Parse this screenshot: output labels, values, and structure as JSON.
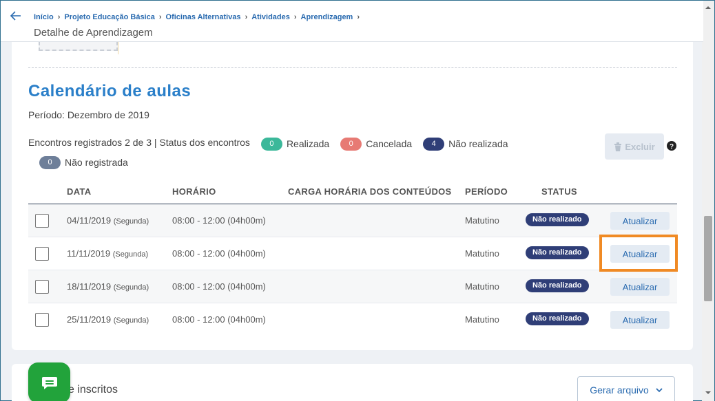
{
  "header": {
    "breadcrumb": [
      "Início",
      "Projeto Educação Básica",
      "Oficinas Alternativas",
      "Atividades",
      "Aprendizagem"
    ],
    "page_title": "Detalhe de Aprendizagem"
  },
  "calendar": {
    "title": "Calendário de aulas",
    "periodo": "Período: Dezembro de 2019",
    "encontros_text": "Encontros registrados 2 de 3 | Status dos encontros",
    "status_counts": [
      {
        "count": "0",
        "label": "Realizada",
        "color": "#3bb89a"
      },
      {
        "count": "0",
        "label": "Cancelada",
        "color": "#e77a74"
      },
      {
        "count": "4",
        "label": "Não realizada",
        "color": "#2f3e77"
      },
      {
        "count": "0",
        "label": "Não registrada",
        "color": "#6e7f99"
      }
    ],
    "excluir_label": "Excluir"
  },
  "table": {
    "headers": {
      "data": "DATA",
      "horario": "HORÁRIO",
      "carga": "CARGA HORÁRIA DOS CONTEÚDOS",
      "periodo": "PERÍODO",
      "status": "STATUS"
    },
    "rows": [
      {
        "date": "04/11/2019",
        "weekday": "(Segunda)",
        "time": "08:00 - 12:00 (04h00m)",
        "periodo": "Matutino",
        "status": "Não realizado",
        "action": "Atualizar"
      },
      {
        "date": "11/11/2019",
        "weekday": "(Segunda)",
        "time": "08:00 - 12:00 (04h00m)",
        "periodo": "Matutino",
        "status": "Não realizado",
        "action": "Atualizar"
      },
      {
        "date": "18/11/2019",
        "weekday": "(Segunda)",
        "time": "08:00 - 12:00 (04h00m)",
        "periodo": "Matutino",
        "status": "Não realizado",
        "action": "Atualizar"
      },
      {
        "date": "25/11/2019",
        "weekday": "(Segunda)",
        "time": "08:00 - 12:00 (04h00m)",
        "periodo": "Matutino",
        "status": "Não realizado",
        "action": "Atualizar"
      }
    ]
  },
  "inscritos": {
    "title_partial": "e inscritos",
    "gerar_label": "Gerar arquivo"
  },
  "colors": {
    "accent": "#2a7fc9",
    "highlight": "#f08a24",
    "chat_green": "#22a33b"
  }
}
